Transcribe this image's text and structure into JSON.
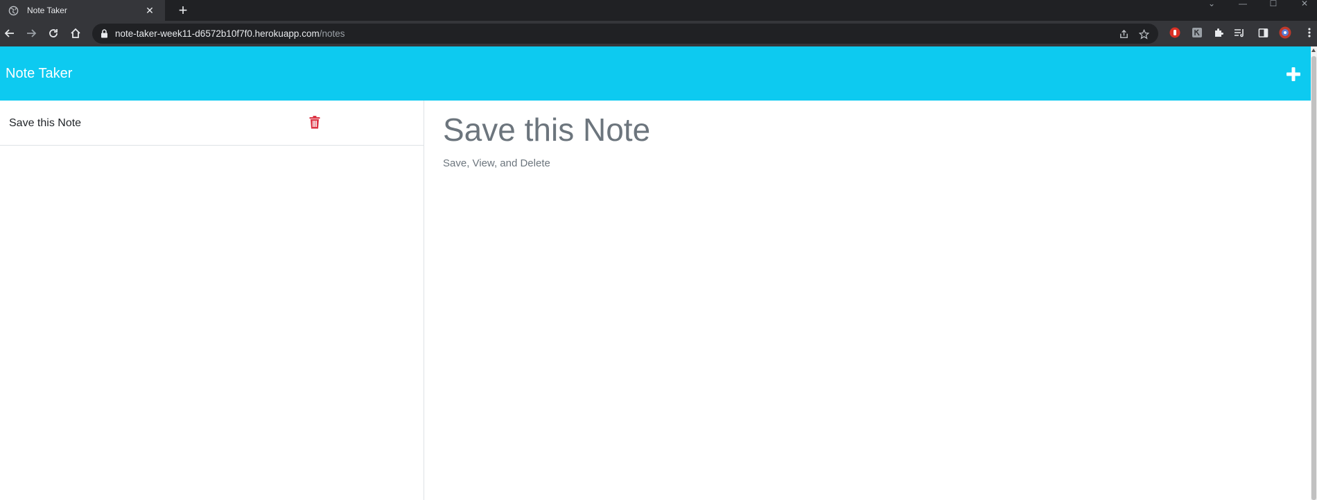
{
  "browser": {
    "tab_title": "Note Taker",
    "tab_close": "✕",
    "new_tab": "+",
    "url_host": "note-taker-week11-d6572b10f7f0.herokuapp.com",
    "url_path": "/notes",
    "window_controls": [
      "⌄",
      "—",
      "☐",
      "✕"
    ]
  },
  "app": {
    "brand": "Note Taker",
    "accent_color": "#0dcaf0",
    "delete_color": "#dc3545"
  },
  "notes": [
    {
      "title": "Save this Note"
    }
  ],
  "active_note": {
    "title": "Save this Note",
    "text": "Save, View, and Delete"
  },
  "icons": [
    "globe-icon",
    "close-icon",
    "back-icon",
    "forward-icon",
    "reload-icon",
    "home-icon",
    "lock-icon",
    "share-icon",
    "star-icon",
    "plus-icon",
    "trash-icon",
    "puzzle-icon",
    "side-panel-icon",
    "menu-icon"
  ]
}
